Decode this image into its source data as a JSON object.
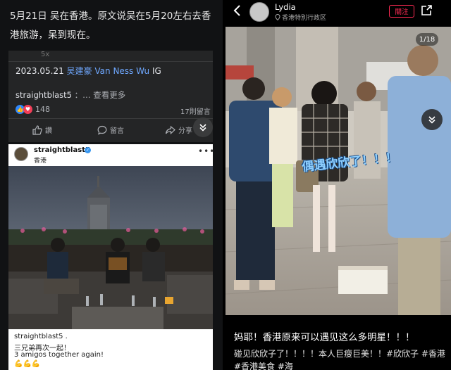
{
  "left": {
    "caption": "5月21日 吴在香港。原文说吴在5月20左右去香港旅游，呆到现在。",
    "fb": {
      "top_fragment": "5x",
      "date": "2023.05.21",
      "tag_cn": "吴建豪",
      "tag_en": "Van Ness Wu",
      "tag_suffix": "IG",
      "username": "straightblast5",
      "separator": "：…",
      "see_more": "查看更多",
      "reaction_count": "148",
      "comment_count": "17則留言",
      "like_label": "讚",
      "comment_label": "留言",
      "share_label": "分享"
    },
    "ig": {
      "username": "straightblast5",
      "location": "香港",
      "caption_user": "straightblast5 .",
      "caption_line1": "三兄弟再次一起！",
      "caption_line2": "3 amigos together again!",
      "caption_line3": "💪💪💪"
    }
  },
  "right": {
    "user_name": "Lydia",
    "location": "香港特別行政区",
    "follow_label": "關注",
    "counter": "1/18",
    "overlay": "偶遇欣欣了！！！",
    "title": "妈耶！香港原来可以遇见这么多明星！！！",
    "body": "碰见欣欣子了！！！！本人巨瘦巨美！！#欣欣子 #香港 #香港美食 #海"
  },
  "colors": {
    "fb_bg": "#242526",
    "link_blue": "#6fa8ff",
    "follow_red": "#ff2b54",
    "ig_verified": "#3897f0"
  }
}
